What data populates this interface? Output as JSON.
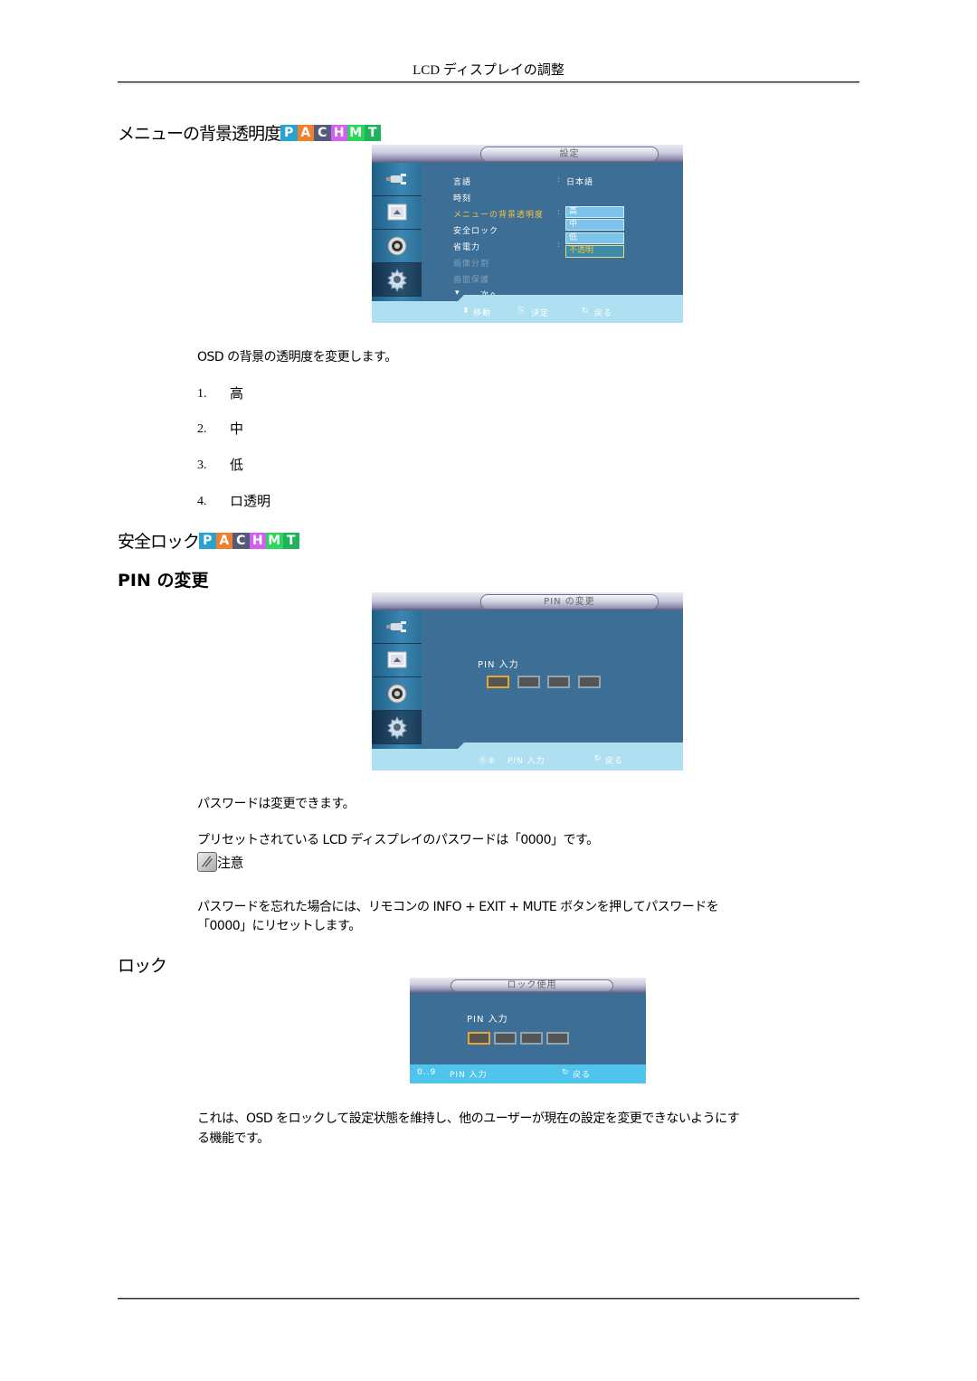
{
  "header": {
    "title": "LCD ディスプレイの調整"
  },
  "badge_letters": [
    {
      "letter": "P",
      "color": "#2aa2cf"
    },
    {
      "letter": "A",
      "color": "#f07f2e"
    },
    {
      "letter": "C",
      "color": "#535a7a"
    },
    {
      "letter": "H",
      "color": "#d25ff0"
    },
    {
      "letter": "M",
      "color": "#2bd65a"
    },
    {
      "letter": "T",
      "color": "#1fb45b"
    }
  ],
  "section1": {
    "title": "メニューの背景透明度",
    "osd": {
      "title": "設定",
      "menu": [
        {
          "label": "言語",
          "value": "日本語",
          "state": "normal"
        },
        {
          "label": "時刻",
          "value": "",
          "state": "normal"
        },
        {
          "label": "メニューの背景透明度",
          "value": "",
          "state": "selected"
        },
        {
          "label": "安全ロック",
          "value": "",
          "state": "normal"
        },
        {
          "label": "省電力",
          "value": "",
          "state": "normal"
        },
        {
          "label": "画像分割",
          "value": "",
          "state": "disabled"
        },
        {
          "label": "画面保護",
          "value": "",
          "state": "disabled"
        },
        {
          "label": "次へ",
          "value": "",
          "state": "normal"
        }
      ],
      "dropdown": [
        "高",
        "中",
        "低",
        "不透明"
      ],
      "dropdown_selected": "不透明",
      "footer": {
        "move": "移動",
        "enter": "決定",
        "back": "戻る"
      }
    },
    "description": "OSD の背景の透明度を変更します。",
    "options": [
      {
        "num": "1.",
        "label": "高"
      },
      {
        "num": "2.",
        "label": "中"
      },
      {
        "num": "3.",
        "label": "低"
      },
      {
        "num": "4.",
        "label": "ロ透明"
      }
    ]
  },
  "section2": {
    "title": "安全ロック",
    "subtitle": "PIN の変更",
    "osd": {
      "title": "PIN の変更",
      "pin_label": "PIN 入力",
      "footer": {
        "digits": "0..9",
        "pin_input": "PIN 入力",
        "back": "戻る"
      }
    },
    "para1": "パスワードは変更できます。",
    "para2": "プリセットされている LCD ディスプレイのパスワードは「0000」です。",
    "note_label": "注意",
    "note_text_line1": "パスワードを忘れた場合には、リモコンの INFO + EXIT + MUTE ボタンを押してパスワードを",
    "note_text_line2": "「0000」にリセットします。"
  },
  "section3": {
    "title": "ロック",
    "osd": {
      "title": "ロック使用",
      "pin_label": "PIN 入力",
      "footer": {
        "digits": "0..9",
        "pin_input": "PIN 入力",
        "back": "戻る"
      }
    },
    "description_line1": "これは、OSD をロックして設定状態を維持し、他のユーザーが現在の設定を変更できないようにす",
    "description_line2": "る機能です。"
  }
}
